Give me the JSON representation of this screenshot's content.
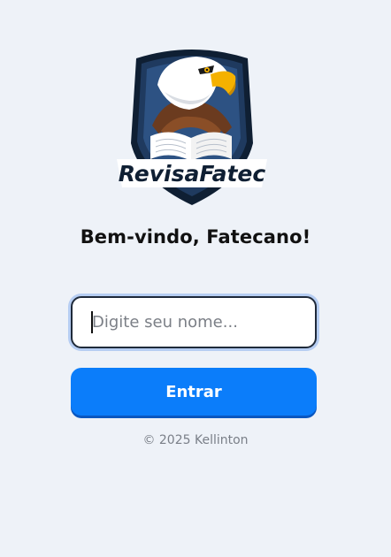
{
  "logo": {
    "wordmark": "RevisaFatec",
    "colors": {
      "shield": "#1f3a5f",
      "shield_edge": "#0f1f33",
      "beak": "#f5b100",
      "book": "#ffffff"
    }
  },
  "welcome": {
    "title": "Bem-vindo, Fatecano!"
  },
  "login": {
    "name_placeholder": "Digite seu nome...",
    "name_value": "",
    "enter_label": "Entrar"
  },
  "footer": {
    "text": "© 2025 Kellinton"
  },
  "colors": {
    "background": "#eef2f8",
    "accent": "#0b7dfa",
    "field_focus_ring": "#b6cdf2"
  }
}
